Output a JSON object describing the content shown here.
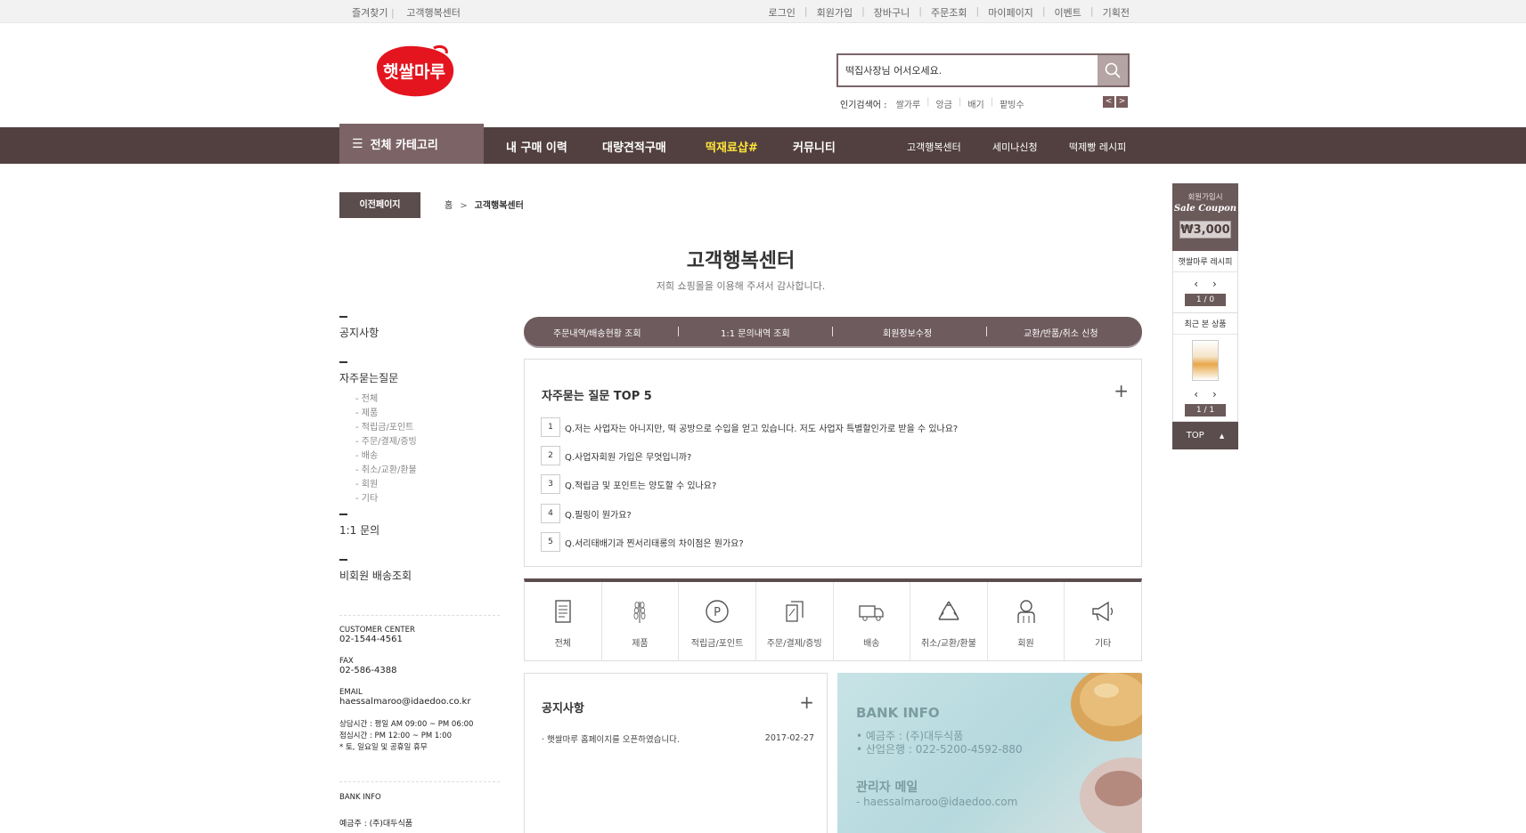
{
  "topbar": {
    "left": [
      "즐겨찾기",
      "고객행복센터"
    ],
    "right": [
      "로그인",
      "회원가입",
      "장바구니",
      "주문조회",
      "마이페이지",
      "이벤트",
      "기획전"
    ]
  },
  "logo": {
    "text": "햇쌀마루",
    "color": "#e4151f"
  },
  "search": {
    "value": "떡집사장님 어서오세요.",
    "popular_label": "인기검색어 :",
    "keywords": [
      "쌀가루",
      "앙금",
      "배기",
      "팥빙수"
    ]
  },
  "nav": {
    "all": "전체 카테고리",
    "main": [
      "내 구매 이력",
      "대량견적구매",
      "떡재료샵#",
      "커뮤니티"
    ],
    "highlight_color": "#ffe33b",
    "sub": [
      "고객행복센터",
      "세미나신청",
      "떡제빵 레시피"
    ]
  },
  "breadcrumb": {
    "prev": "이전페이지",
    "home": "홈",
    "sep": ">",
    "current": "고객행복센터"
  },
  "page": {
    "title": "고객행복센터",
    "subtitle": "저희 쇼핑몰을 이용해 주셔서 감사합니다."
  },
  "sidebar": {
    "notice": "공지사항",
    "faq": "자주묻는질문",
    "faq_sub": [
      "- 전체",
      "- 제품",
      "- 적립금/포인트",
      "- 주문/결제/증빙",
      "- 배송",
      "- 취소/교환/환불",
      "- 회원",
      "- 기타"
    ],
    "qna": "1:1 문의",
    "guest": "비회원 배송조회",
    "cs_center_label": "CUSTOMER CENTER",
    "cs_center_tel": "02-1544-4561",
    "fax_label": "FAX",
    "fax": "02-586-4388",
    "email_label": "EMAIL",
    "email": "haessalmaroo@idaedoo.co.kr",
    "hours1": "상담시간 : 평일 AM 09:00 ~ PM 06:00",
    "hours2": "점심시간 : PM 12:00 ~ PM 1:00",
    "hours3": "* 토, 일요일 및 공휴일 휴무",
    "bank_label": "BANK INFO",
    "bank_owner": "예금주 : (주)대두식품"
  },
  "tabs": [
    "주문내역/배송현황 조회",
    "1:1 문의내역 조회",
    "회원정보수정",
    "교환/반품/취소 신청"
  ],
  "faq_box": {
    "title": "자주묻는 질문 TOP 5",
    "items": [
      {
        "num": "1",
        "q": "Q.저는 사업자는 아니지만, 떡 공방으로 수입을 얻고 있습니다. 저도 사업자 특별할인가로 받을 수 있나요?"
      },
      {
        "num": "2",
        "q": "Q.사업자회원 가입은 무엇입니까?"
      },
      {
        "num": "3",
        "q": "Q.적립금 및 포인트는 양도할 수 있나요?"
      },
      {
        "num": "4",
        "q": "Q.필링이 뭔가요?"
      },
      {
        "num": "5",
        "q": "Q.서리태배기과 찐서리태롱의 차이점은 뭔가요?"
      }
    ]
  },
  "categories": [
    {
      "label": "전체",
      "icon": "document-icon"
    },
    {
      "label": "제품",
      "icon": "wheat-icon"
    },
    {
      "label": "적립금/포인트",
      "icon": "point-icon"
    },
    {
      "label": "주문/결제/증빙",
      "icon": "payment-icon"
    },
    {
      "label": "배송",
      "icon": "truck-icon"
    },
    {
      "label": "취소/교환/환불",
      "icon": "recycle-icon"
    },
    {
      "label": "회원",
      "icon": "member-icon"
    },
    {
      "label": "기타",
      "icon": "megaphone-icon"
    }
  ],
  "notice_box": {
    "title": "공지사항",
    "item": "· 햇쌀마루 홈페이지를 오픈하였습니다.",
    "date": "2017-02-27"
  },
  "bank_banner": {
    "title": "BANK INFO",
    "line1": "• 예금주 : (주)대두식품",
    "line2": "• 산업은행 : 022-5200-4592-880",
    "admin_title": "관리자 메일",
    "admin_email": "- haessalmaroo@idaedoo.com"
  },
  "quick": {
    "coupon_top": "회원가입시",
    "coupon_name": "Sale Coupon",
    "coupon_amount": "₩3,000",
    "recipe_label": "햇쌀마루 레시피",
    "recipe_page": "1 / 0",
    "recent_label": "최근 본 상품",
    "recent_page": "1 / 1",
    "top": "TOP"
  },
  "colors": {
    "brand_dark": "#51403f",
    "brand_mid": "#7b6366",
    "logo_red": "#e4151f"
  }
}
